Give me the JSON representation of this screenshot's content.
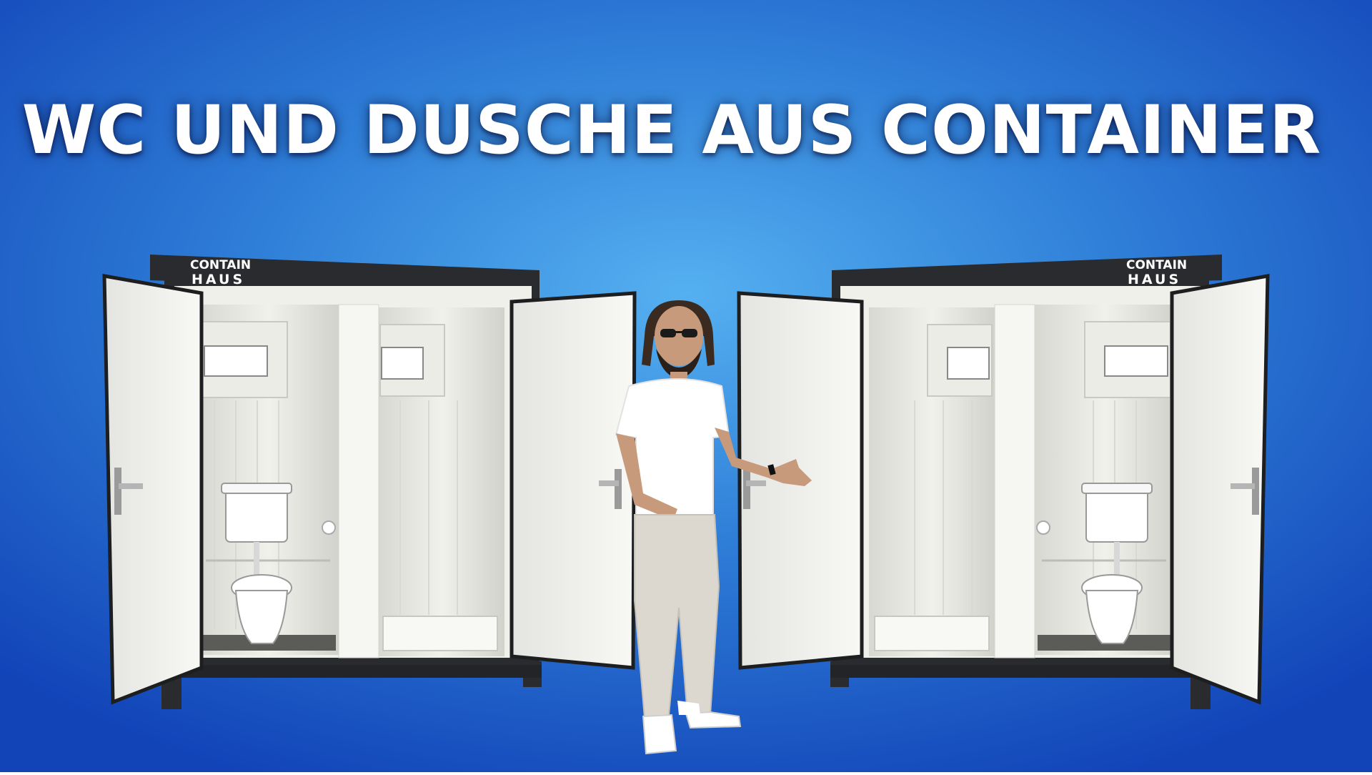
{
  "headline": "WC UND DUSCHE AUS CONTAINER",
  "containers": [
    {
      "logo_line1": "CONTAIN",
      "logo_line2": "HAUS"
    },
    {
      "logo_line1": "CONTAIN",
      "logo_line2": "HAUS"
    }
  ],
  "colors": {
    "background_center": "#4aa3ea",
    "background_edge": "#1244b8",
    "container_frame": "#2a2b2e",
    "panel": "#f2f2ee"
  },
  "icons": [
    "toilet",
    "shower-cabin",
    "door-handle",
    "person-presenter"
  ]
}
